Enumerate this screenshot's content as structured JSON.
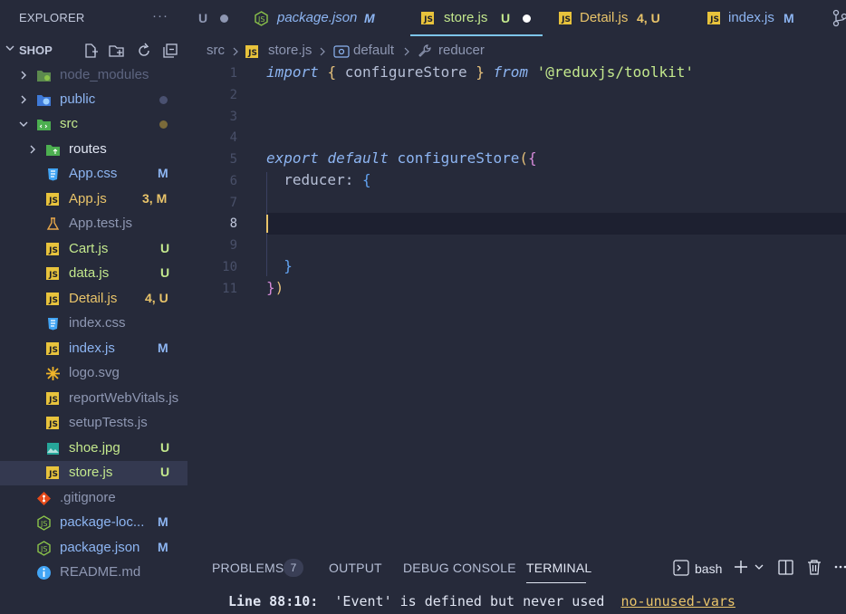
{
  "explorer": {
    "title": "EXPLORER",
    "more": "···",
    "root": "SHOP",
    "items": [
      {
        "name": "node_modules",
        "color": "#5d6580"
      },
      {
        "name": "public",
        "color": "#8db5f2"
      },
      {
        "name": "src",
        "color": "#c3e88d"
      },
      {
        "name": "routes",
        "color": "#e0e5f2"
      },
      {
        "name": "App.css",
        "badge": "M",
        "color": "#8db5f2"
      },
      {
        "name": "App.js",
        "badge": "3, M",
        "color": "#e9c46a"
      },
      {
        "name": "App.test.js",
        "color": "#8e97b2"
      },
      {
        "name": "Cart.js",
        "badge": "U",
        "color": "#c3e88d"
      },
      {
        "name": "data.js",
        "badge": "U",
        "color": "#c3e88d"
      },
      {
        "name": "Detail.js",
        "badge": "4, U",
        "color": "#e9c46a"
      },
      {
        "name": "index.css",
        "color": "#8e97b2"
      },
      {
        "name": "index.js",
        "badge": "M",
        "color": "#8db5f2"
      },
      {
        "name": "logo.svg",
        "color": "#8e97b2"
      },
      {
        "name": "reportWebVitals.js",
        "color": "#8e97b2"
      },
      {
        "name": "setupTests.js",
        "color": "#8e97b2"
      },
      {
        "name": "shoe.jpg",
        "badge": "U",
        "color": "#c3e88d"
      },
      {
        "name": "store.js",
        "badge": "U",
        "color": "#c3e88d"
      },
      {
        "name": ".gitignore",
        "color": "#8e97b2"
      },
      {
        "name": "package-loc...",
        "badge": "M",
        "color": "#8db5f2"
      },
      {
        "name": "package.json",
        "badge": "M",
        "color": "#8db5f2"
      },
      {
        "name": "README.md",
        "color": "#8e97b2"
      }
    ]
  },
  "tabs": [
    {
      "name": "",
      "status": "U"
    },
    {
      "name": "package.json",
      "status": "M"
    },
    {
      "name": "store.js",
      "status": "U"
    },
    {
      "name": "Detail.js",
      "status": "4, U"
    },
    {
      "name": "index.js",
      "status": "M"
    }
  ],
  "breadcrumb": [
    "src",
    "store.js",
    "default",
    "reducer"
  ],
  "editor": {
    "line_numbers": [
      "1",
      "2",
      "3",
      "4",
      "5",
      "6",
      "7",
      "8",
      "9",
      "10",
      "11"
    ],
    "code": {
      "l1_import": "import",
      "l1_open": "{",
      "l1_name": " configureStore ",
      "l1_close": "}",
      "l1_from": "from",
      "l1_str": "'@reduxjs/toolkit'",
      "l5_export": "export",
      "l5_default": "default",
      "l5_fn": "configureStore",
      "l5_paren": "(",
      "l5_brace": "{",
      "l6_key": "reducer:",
      "l6_brace": "{",
      "l10_brace": "}",
      "l11_brace": "}",
      "l11_paren": ")"
    }
  },
  "panel": {
    "tabs": [
      "PROBLEMS",
      "OUTPUT",
      "DEBUG CONSOLE",
      "TERMINAL"
    ],
    "problems_count": "7",
    "terminal_shell": "bash",
    "terminal_line": {
      "label": "Line 88:10:",
      "message": "'Event' is defined but never used",
      "rule": "no-unused-vars"
    }
  }
}
